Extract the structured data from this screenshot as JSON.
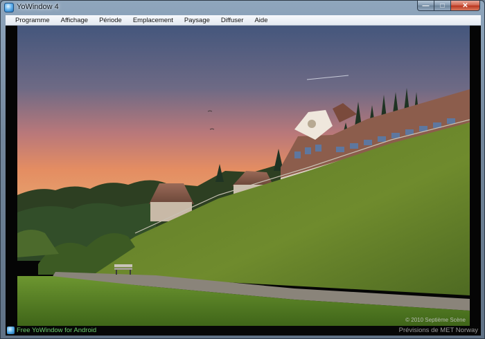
{
  "window": {
    "title": "YoWindow 4",
    "controls": {
      "minimize_icon": "minimize-icon",
      "maximize_icon": "maximize-icon",
      "close_icon": "close-icon"
    }
  },
  "menu": {
    "items": [
      "Programme",
      "Affichage",
      "Période",
      "Emplacement",
      "Paysage",
      "Diffuser",
      "Aide"
    ]
  },
  "scene": {
    "name": "landscape-photo",
    "copyright": "© 2010 Septième Scène"
  },
  "status": {
    "promo": "Free YoWindow for Android",
    "credit": "Prévisions de MET Norway",
    "promo_color": "#6fd06f"
  },
  "colors": {
    "sky_top": "#46587e",
    "sky_horizon": "#e49062",
    "grass": "#6f8a2c",
    "frame": "#73879c"
  }
}
